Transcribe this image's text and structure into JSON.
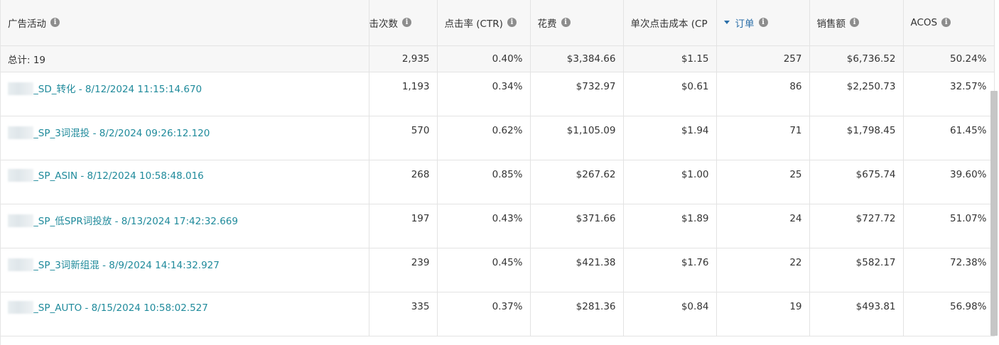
{
  "columns": {
    "campaign": "广告活动",
    "impressions_partial": "击次数",
    "ctr": "点击率 (CTR)",
    "spend": "花费",
    "cpc": "单次点击成本 (CP",
    "orders": "订单",
    "sales": "销售额",
    "acos": "ACOS"
  },
  "info_glyph": "i",
  "total": {
    "label": "总计: 19",
    "clicks": "2,935",
    "ctr": "0.40%",
    "spend": "$3,384.66",
    "cpc": "$1.15",
    "orders": "257",
    "sales": "$6,736.52",
    "acos": "50.24%"
  },
  "rows": [
    {
      "name": "_SD_转化 - 8/12/2024 11:15:14.670",
      "clicks": "1,193",
      "ctr": "0.34%",
      "spend": "$732.97",
      "cpc": "$0.61",
      "orders": "86",
      "sales": "$2,250.73",
      "acos": "32.57%"
    },
    {
      "name": "_SP_3词混投 - 8/2/2024 09:26:12.120",
      "clicks": "570",
      "ctr": "0.62%",
      "spend": "$1,105.09",
      "cpc": "$1.94",
      "orders": "71",
      "sales": "$1,798.45",
      "acos": "61.45%"
    },
    {
      "name": "_SP_ASIN - 8/12/2024 10:58:48.016",
      "clicks": "268",
      "ctr": "0.85%",
      "spend": "$267.62",
      "cpc": "$1.00",
      "orders": "25",
      "sales": "$675.74",
      "acos": "39.60%"
    },
    {
      "name": "_SP_低SPR词投放 - 8/13/2024 17:42:32.669",
      "clicks": "197",
      "ctr": "0.43%",
      "spend": "$371.66",
      "cpc": "$1.89",
      "orders": "24",
      "sales": "$727.72",
      "acos": "51.07%"
    },
    {
      "name": "_SP_3词新组混 - 8/9/2024 14:14:32.927",
      "clicks": "239",
      "ctr": "0.45%",
      "spend": "$421.38",
      "cpc": "$1.76",
      "orders": "22",
      "sales": "$582.17",
      "acos": "72.38%"
    },
    {
      "name": "_SP_AUTO - 8/15/2024 10:58:02.527",
      "clicks": "335",
      "ctr": "0.37%",
      "spend": "$281.36",
      "cpc": "$0.84",
      "orders": "19",
      "sales": "$493.81",
      "acos": "56.98%"
    }
  ],
  "colors": {
    "link": "#1f8a9b",
    "sorted_header": "#2a6ea8",
    "header_bg": "#f7f7f7",
    "border": "#e3e3e3"
  },
  "icons": {
    "info": "info-icon",
    "sort": "sort-desc-icon"
  }
}
